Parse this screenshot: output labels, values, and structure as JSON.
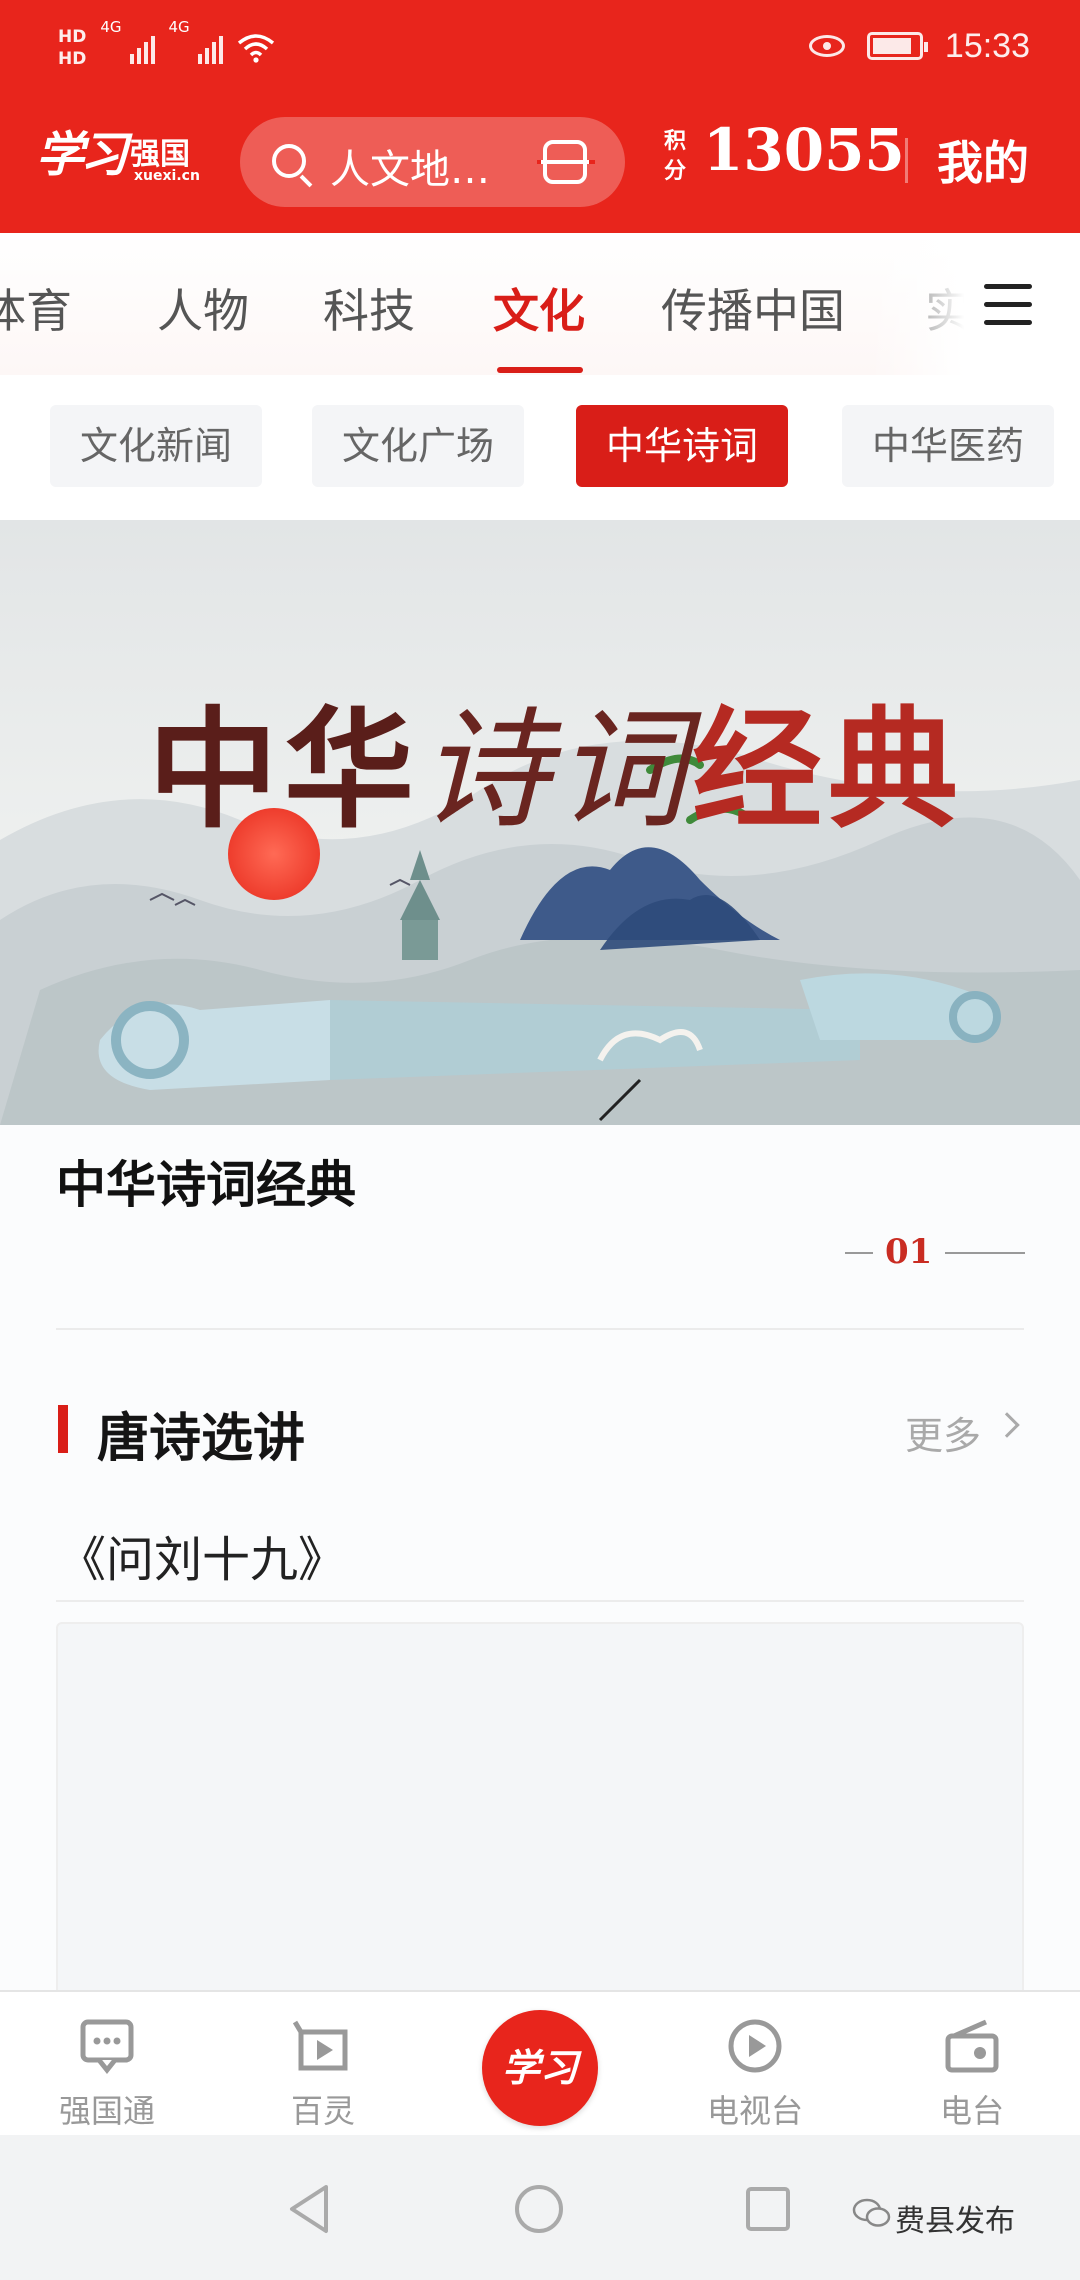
{
  "status_bar": {
    "hd1": "HD",
    "hd2": "HD",
    "net1": "4G",
    "net2": "4G",
    "time": "15:33"
  },
  "header": {
    "logo_text": "学习",
    "logo_sub": "强国",
    "logo_url": "xuexi.cn",
    "search_placeholder": "人文地…",
    "points_label": "积分",
    "points_value": "13055",
    "mine_label": "我的"
  },
  "tabs": {
    "items": [
      "体育",
      "人物",
      "科技",
      "文化",
      "传播中国",
      "实"
    ],
    "active": "文化"
  },
  "subtabs": {
    "items": [
      "文化新闻",
      "文化广场",
      "中华诗词",
      "中华医药"
    ],
    "active": "中华诗词"
  },
  "banner": {
    "calligraphy_part1": "中华",
    "calligraphy_part2": "诗词",
    "calligraphy_part3": "经典",
    "title": "中华诗词经典",
    "page_number": "01"
  },
  "section": {
    "title": "唐诗选讲",
    "more_label": "更多",
    "first_item": "《问刘十九》"
  },
  "bottom_nav": {
    "items": [
      "强国通",
      "百灵",
      "学习",
      "电视台",
      "电台"
    ]
  },
  "watermark": "费县发布",
  "colors": {
    "brand_red": "#e8251c",
    "active_red": "#d91e18"
  }
}
